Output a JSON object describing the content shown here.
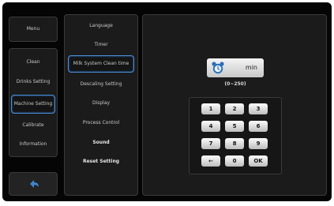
{
  "left_menu": {
    "menu_label": "Menu",
    "items": [
      "Clean",
      "Drinks Setting",
      "Machine Setting",
      "Calibrate",
      "Information"
    ],
    "selected_index": 2,
    "back_icon": "back-arrow-icon"
  },
  "sub_menu": {
    "items": [
      "Language",
      "Timer",
      "Milk System Clean time",
      "Descaling Setting",
      "Display",
      "Process Control",
      "Sound",
      "Reset Setting"
    ],
    "selected_index": 2
  },
  "editor": {
    "icon": "alarm-clock-icon",
    "unit": "min",
    "range": "(0~250)",
    "keypad": [
      "1",
      "2",
      "3",
      "4",
      "5",
      "6",
      "7",
      "8",
      "9",
      "←",
      "0",
      "OK"
    ]
  },
  "colors": {
    "accent": "#4a8fd6",
    "icon_blue": "#2b6fb8"
  }
}
